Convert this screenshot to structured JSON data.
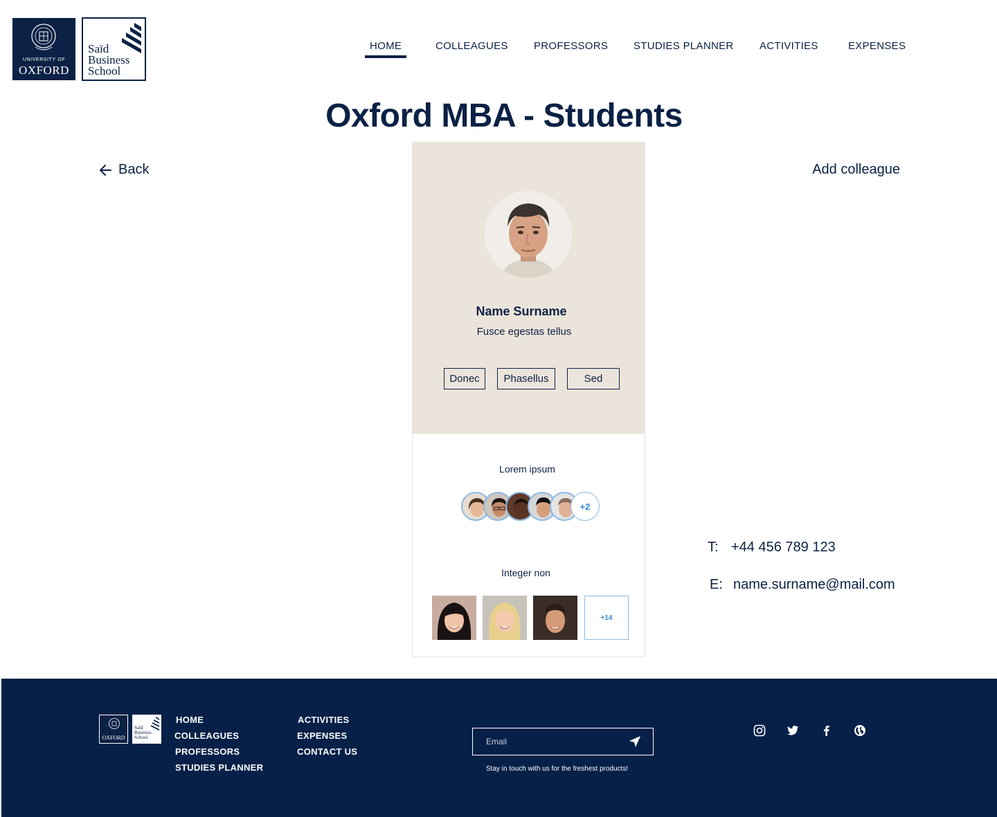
{
  "brand": {
    "university_line1": "UNIVERSITY OF",
    "university_line2": "OXFORD",
    "school_line1": "Saïd",
    "school_line2": "Business",
    "school_line3": "School"
  },
  "nav": {
    "items": [
      {
        "label": "HOME",
        "active": true
      },
      {
        "label": "COLLEAGUES"
      },
      {
        "label": "PROFESSORS"
      },
      {
        "label": "STUDIES PLANNER"
      },
      {
        "label": "ACTIVITIES"
      },
      {
        "label": "EXPENSES"
      }
    ]
  },
  "page": {
    "title": "Oxford MBA - Students",
    "back_label": "Back",
    "add_label": "Add colleague"
  },
  "profile": {
    "name": "Name Surname",
    "subtitle": "Fusce egestas tellus",
    "tags": [
      "Donec",
      "Phasellus",
      "Sed"
    ],
    "section1": {
      "label": "Lorem ipsum",
      "more": "+2"
    },
    "section2": {
      "label": "Integer non",
      "more": "+14"
    }
  },
  "contact": {
    "phone_label": "T:",
    "phone": "+44 456 789 123",
    "email_label": "E:",
    "email": "name.surname@mail.com"
  },
  "footer": {
    "col1": [
      "HOME",
      "COLLEAGUES",
      "PROFESSORS",
      "STUDIES PLANNER"
    ],
    "col2": [
      "ACTIVITIES",
      "EXPENSES",
      "CONTACT US"
    ],
    "email_placeholder": "Email",
    "tagline": "Stay in touch with us for the freshest products!",
    "logo_text": "OXFORD",
    "logo_school": "Saïd Business School",
    "social": [
      "instagram-icon",
      "twitter-icon",
      "facebook-icon",
      "globe-icon"
    ]
  },
  "colors": {
    "navy": "#0b2145",
    "footer": "#062048",
    "card_beige": "#ebe4da",
    "accent_blue": "#2f86d6"
  }
}
